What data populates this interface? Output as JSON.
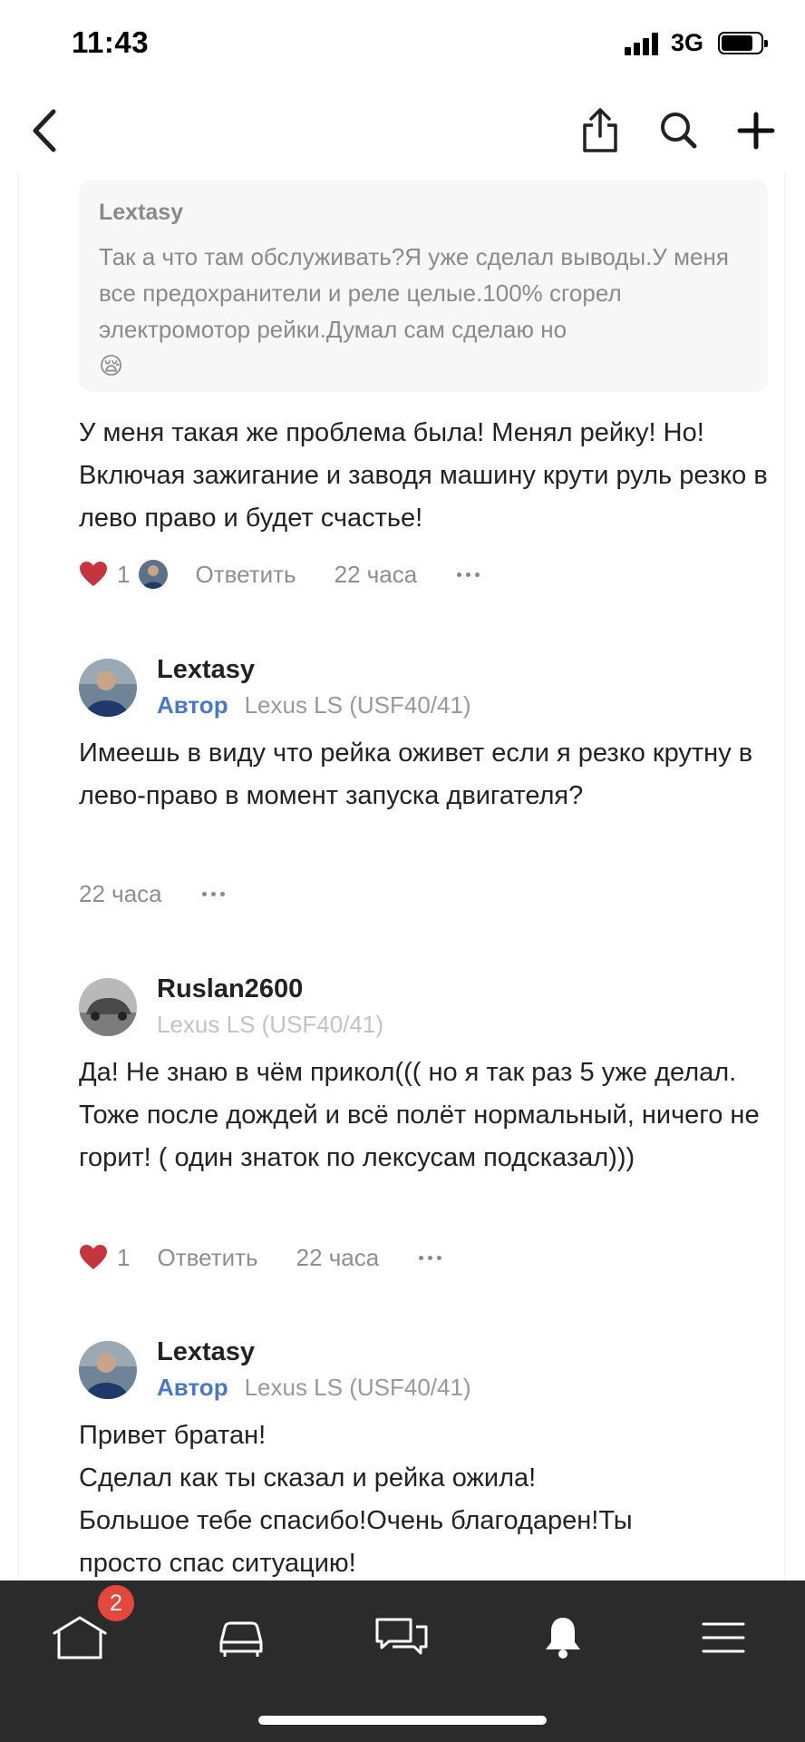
{
  "status_bar": {
    "time": "11:43",
    "network": "3G"
  },
  "nav": {
    "back_icon": "chevron-left-icon",
    "share_icon": "share-icon",
    "search_icon": "search-icon",
    "add_icon": "plus-icon"
  },
  "quote": {
    "author": "Lextasy",
    "text": "Так а что там обслуживать?Я уже сделал выводы.У меня все предохранители и реле целые.100% сгорел электромотор рейки.Думал сам сделаю но",
    "emoji": "😪"
  },
  "comments": [
    {
      "text": "У меня такая же проблема была! Менял рейку! Но! Включая зажигание и заводя машину крути руль резко в лево право и будет счастье!",
      "likes": "1",
      "reply_label": "Ответить",
      "time": "22 часа"
    },
    {
      "author": "Lextasy",
      "badge": "Автор",
      "car": "Lexus LS (USF40/41)",
      "text": "Имеешь в виду что рейка оживет если я резко крутну в лево-право в момент запуска двигателя?",
      "time": "22 часа"
    },
    {
      "author": "Ruslan2600",
      "car": "Lexus LS (USF40/41)",
      "text": "Да! Не знаю в чём прикол((( но я так раз 5 уже делал. Тоже после дождей и всё полёт нормальный, ничего не горит! ( один знаток по лексусам подсказал)))",
      "likes": "1",
      "reply_label": "Ответить",
      "time": "22 часа"
    },
    {
      "author": "Lextasy",
      "badge": "Автор",
      "car": "Lexus LS (USF40/41)",
      "text_lines": [
        "Привет братан!",
        "Сделал как ты сказал и рейка ожила!",
        "Большое тебе спасибо!Очень благодарен!Ты",
        "просто спас ситуацию!"
      ]
    }
  ],
  "tab_bar": {
    "home_badge": "2",
    "tabs": [
      "home-icon",
      "car-icon",
      "chat-icon",
      "bell-icon",
      "menu-icon"
    ]
  },
  "colors": {
    "accent": "#4a78c9",
    "like": "#c5343f",
    "badge": "#e5473c",
    "tabbar": "#2b2b2b"
  }
}
